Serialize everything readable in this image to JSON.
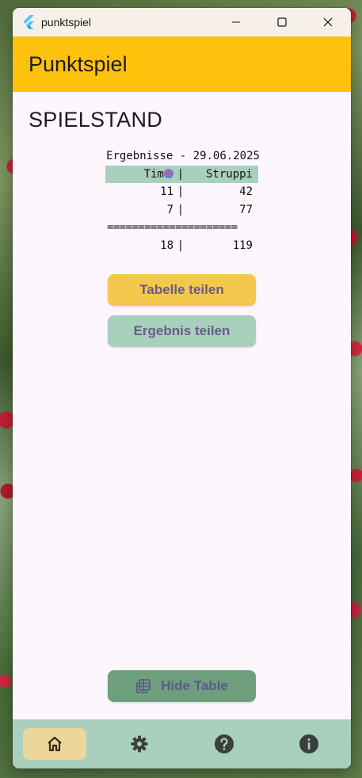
{
  "window": {
    "title": "punktspiel"
  },
  "appbar": {
    "title": "Punktspiel"
  },
  "main": {
    "section_title": "SPIELSTAND",
    "scoreboard": {
      "date_line": "Ergebnisse - 29.06.2025",
      "players": [
        "Tim",
        "Struppi"
      ],
      "player1_badge_icon": "confetti-emoji-icon",
      "rows": [
        {
          "p1": "11",
          "p2": "42"
        },
        {
          "p1": "7",
          "p2": "77"
        }
      ],
      "separator": "=====================",
      "totals": {
        "p1": "18",
        "p2": "119"
      },
      "divider_char": "|"
    },
    "buttons": {
      "share_table": "Tabelle teilen",
      "share_result": "Ergebnis teilen",
      "hide_table": "Hide Table",
      "hide_table_icon": "table-icon"
    }
  },
  "bottom_nav": {
    "items": [
      {
        "icon": "home-icon",
        "active": true
      },
      {
        "icon": "gear-icon",
        "active": false
      },
      {
        "icon": "help-icon",
        "active": false
      },
      {
        "icon": "info-icon",
        "active": false
      }
    ]
  },
  "colors": {
    "appbar": "#ffc20c",
    "share_table_button": "#f4c74d",
    "share_result_button": "#a8d0bd",
    "hide_table_button": "#6d9f7d",
    "navbar": "#a8d0bd",
    "nav_active": "#ecd69a"
  }
}
